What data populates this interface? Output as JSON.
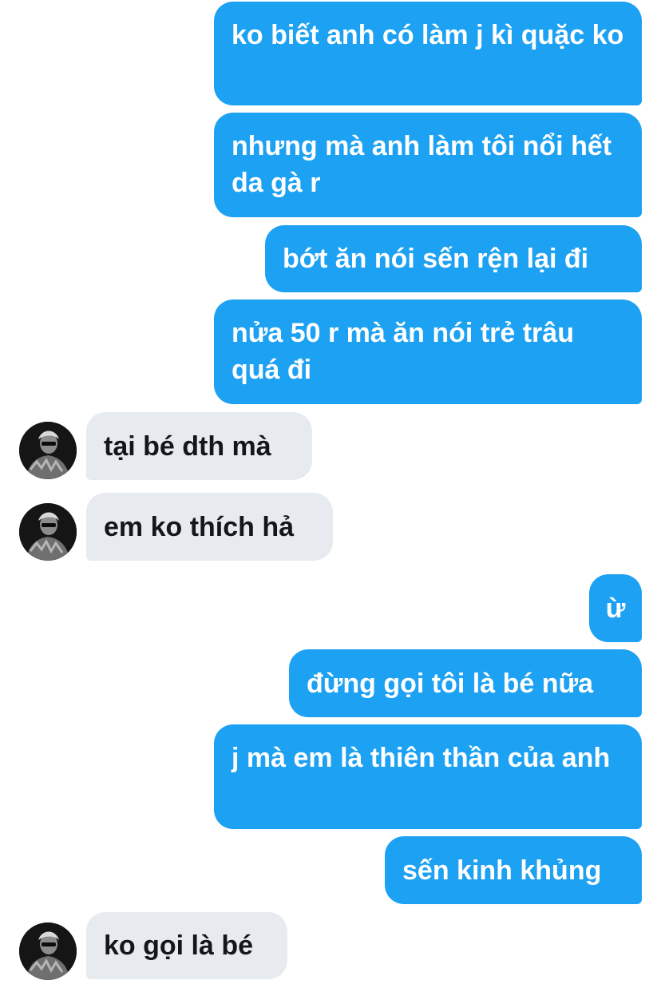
{
  "conversation": {
    "messages": [
      {
        "side": "sent",
        "text": "ko biết anh có làm j kì quặc ko"
      },
      {
        "side": "sent",
        "text": "nhưng mà anh làm tôi nổi hết da gà r"
      },
      {
        "side": "sent",
        "text": "bớt ăn nói sến rện lại đi"
      },
      {
        "side": "sent",
        "text": "nửa 50 r mà ăn nói trẻ trâu quá đi"
      },
      {
        "side": "received",
        "text": "tại bé dth mà"
      },
      {
        "side": "received",
        "text": "em ko thích hả"
      },
      {
        "side": "sent",
        "text": "ừ"
      },
      {
        "side": "sent",
        "text": "đừng gọi tôi là bé nữa"
      },
      {
        "side": "sent",
        "text": "j mà em là thiên thần của anh"
      },
      {
        "side": "sent",
        "text": "sến kinh khủng"
      },
      {
        "side": "received",
        "text": "ko gọi là bé"
      }
    ]
  },
  "colors": {
    "sent_bubble": "#1da1f2",
    "received_bubble": "#e7ebef",
    "received_text": "#14171a"
  },
  "icons": {
    "avatar": "contact-avatar-photo"
  }
}
